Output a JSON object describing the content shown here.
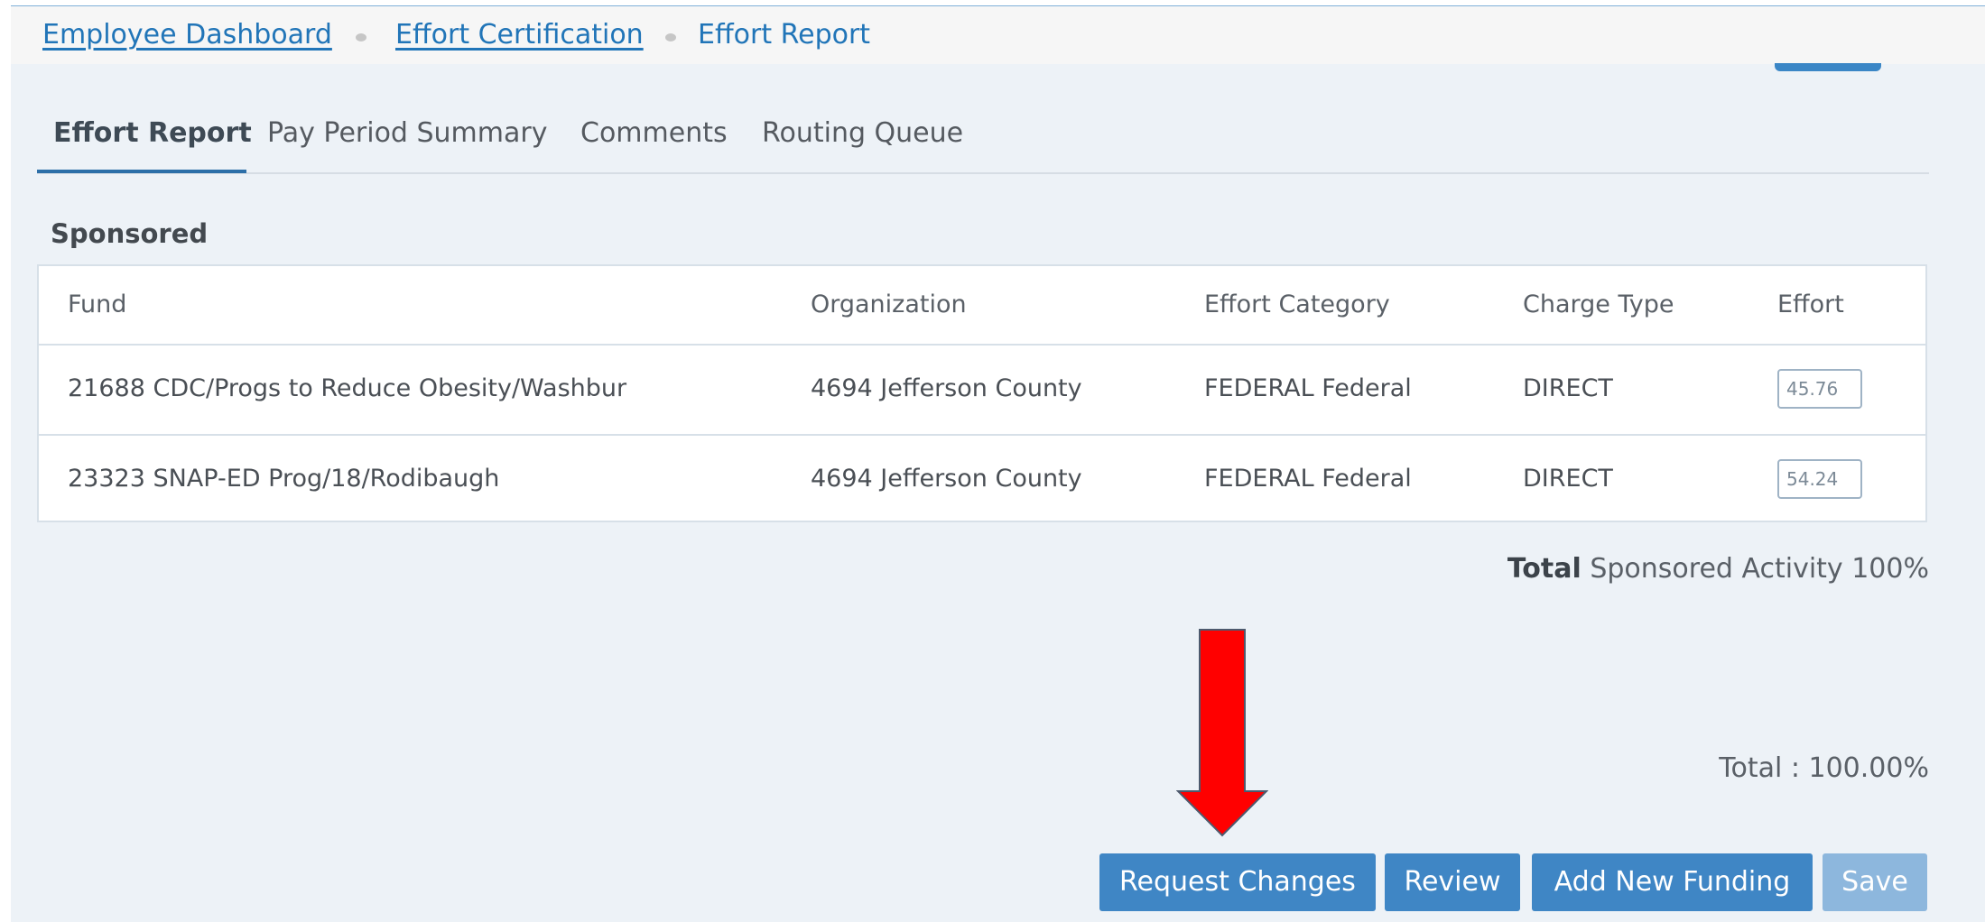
{
  "breadcrumb": [
    {
      "label": "Employee Dashboard"
    },
    {
      "label": "Effort Certification"
    },
    {
      "label": "Effort Report"
    }
  ],
  "tabs": [
    {
      "label": "Effort Report",
      "active": true
    },
    {
      "label": "Pay Period Summary",
      "active": false
    },
    {
      "label": "Comments",
      "active": false
    },
    {
      "label": "Routing Queue",
      "active": false
    }
  ],
  "section": {
    "title": "Sponsored"
  },
  "table": {
    "headers": [
      "Fund",
      "Organization",
      "Effort Category",
      "Charge Type",
      "Effort"
    ],
    "rows": [
      {
        "fund": "21688 CDC/Progs to Reduce Obesity/Washbur",
        "organization": "4694 Jefferson County",
        "category": "FEDERAL Federal",
        "charge_type": "DIRECT",
        "effort": "45.76"
      },
      {
        "fund": "23323 SNAP-ED Prog/18/Rodibaugh",
        "organization": "4694 Jefferson County",
        "category": "FEDERAL Federal",
        "charge_type": "DIRECT",
        "effort": "54.24"
      }
    ]
  },
  "totals": {
    "sponsored_bold": "Total",
    "sponsored_text": "Sponsored Activity 100%",
    "grand": "Total : 100.00%"
  },
  "buttons": {
    "request_changes": "Request Changes",
    "review": "Review",
    "add_new_funding": "Add New Funding",
    "save": "Save"
  },
  "colors": {
    "link": "#2175b8",
    "button": "#3f86c5",
    "button_disabled": "#8db7dd",
    "arrow": "#ff0000",
    "background": "#edf2f7"
  },
  "icons": {
    "annotation": "down-arrow-icon"
  }
}
